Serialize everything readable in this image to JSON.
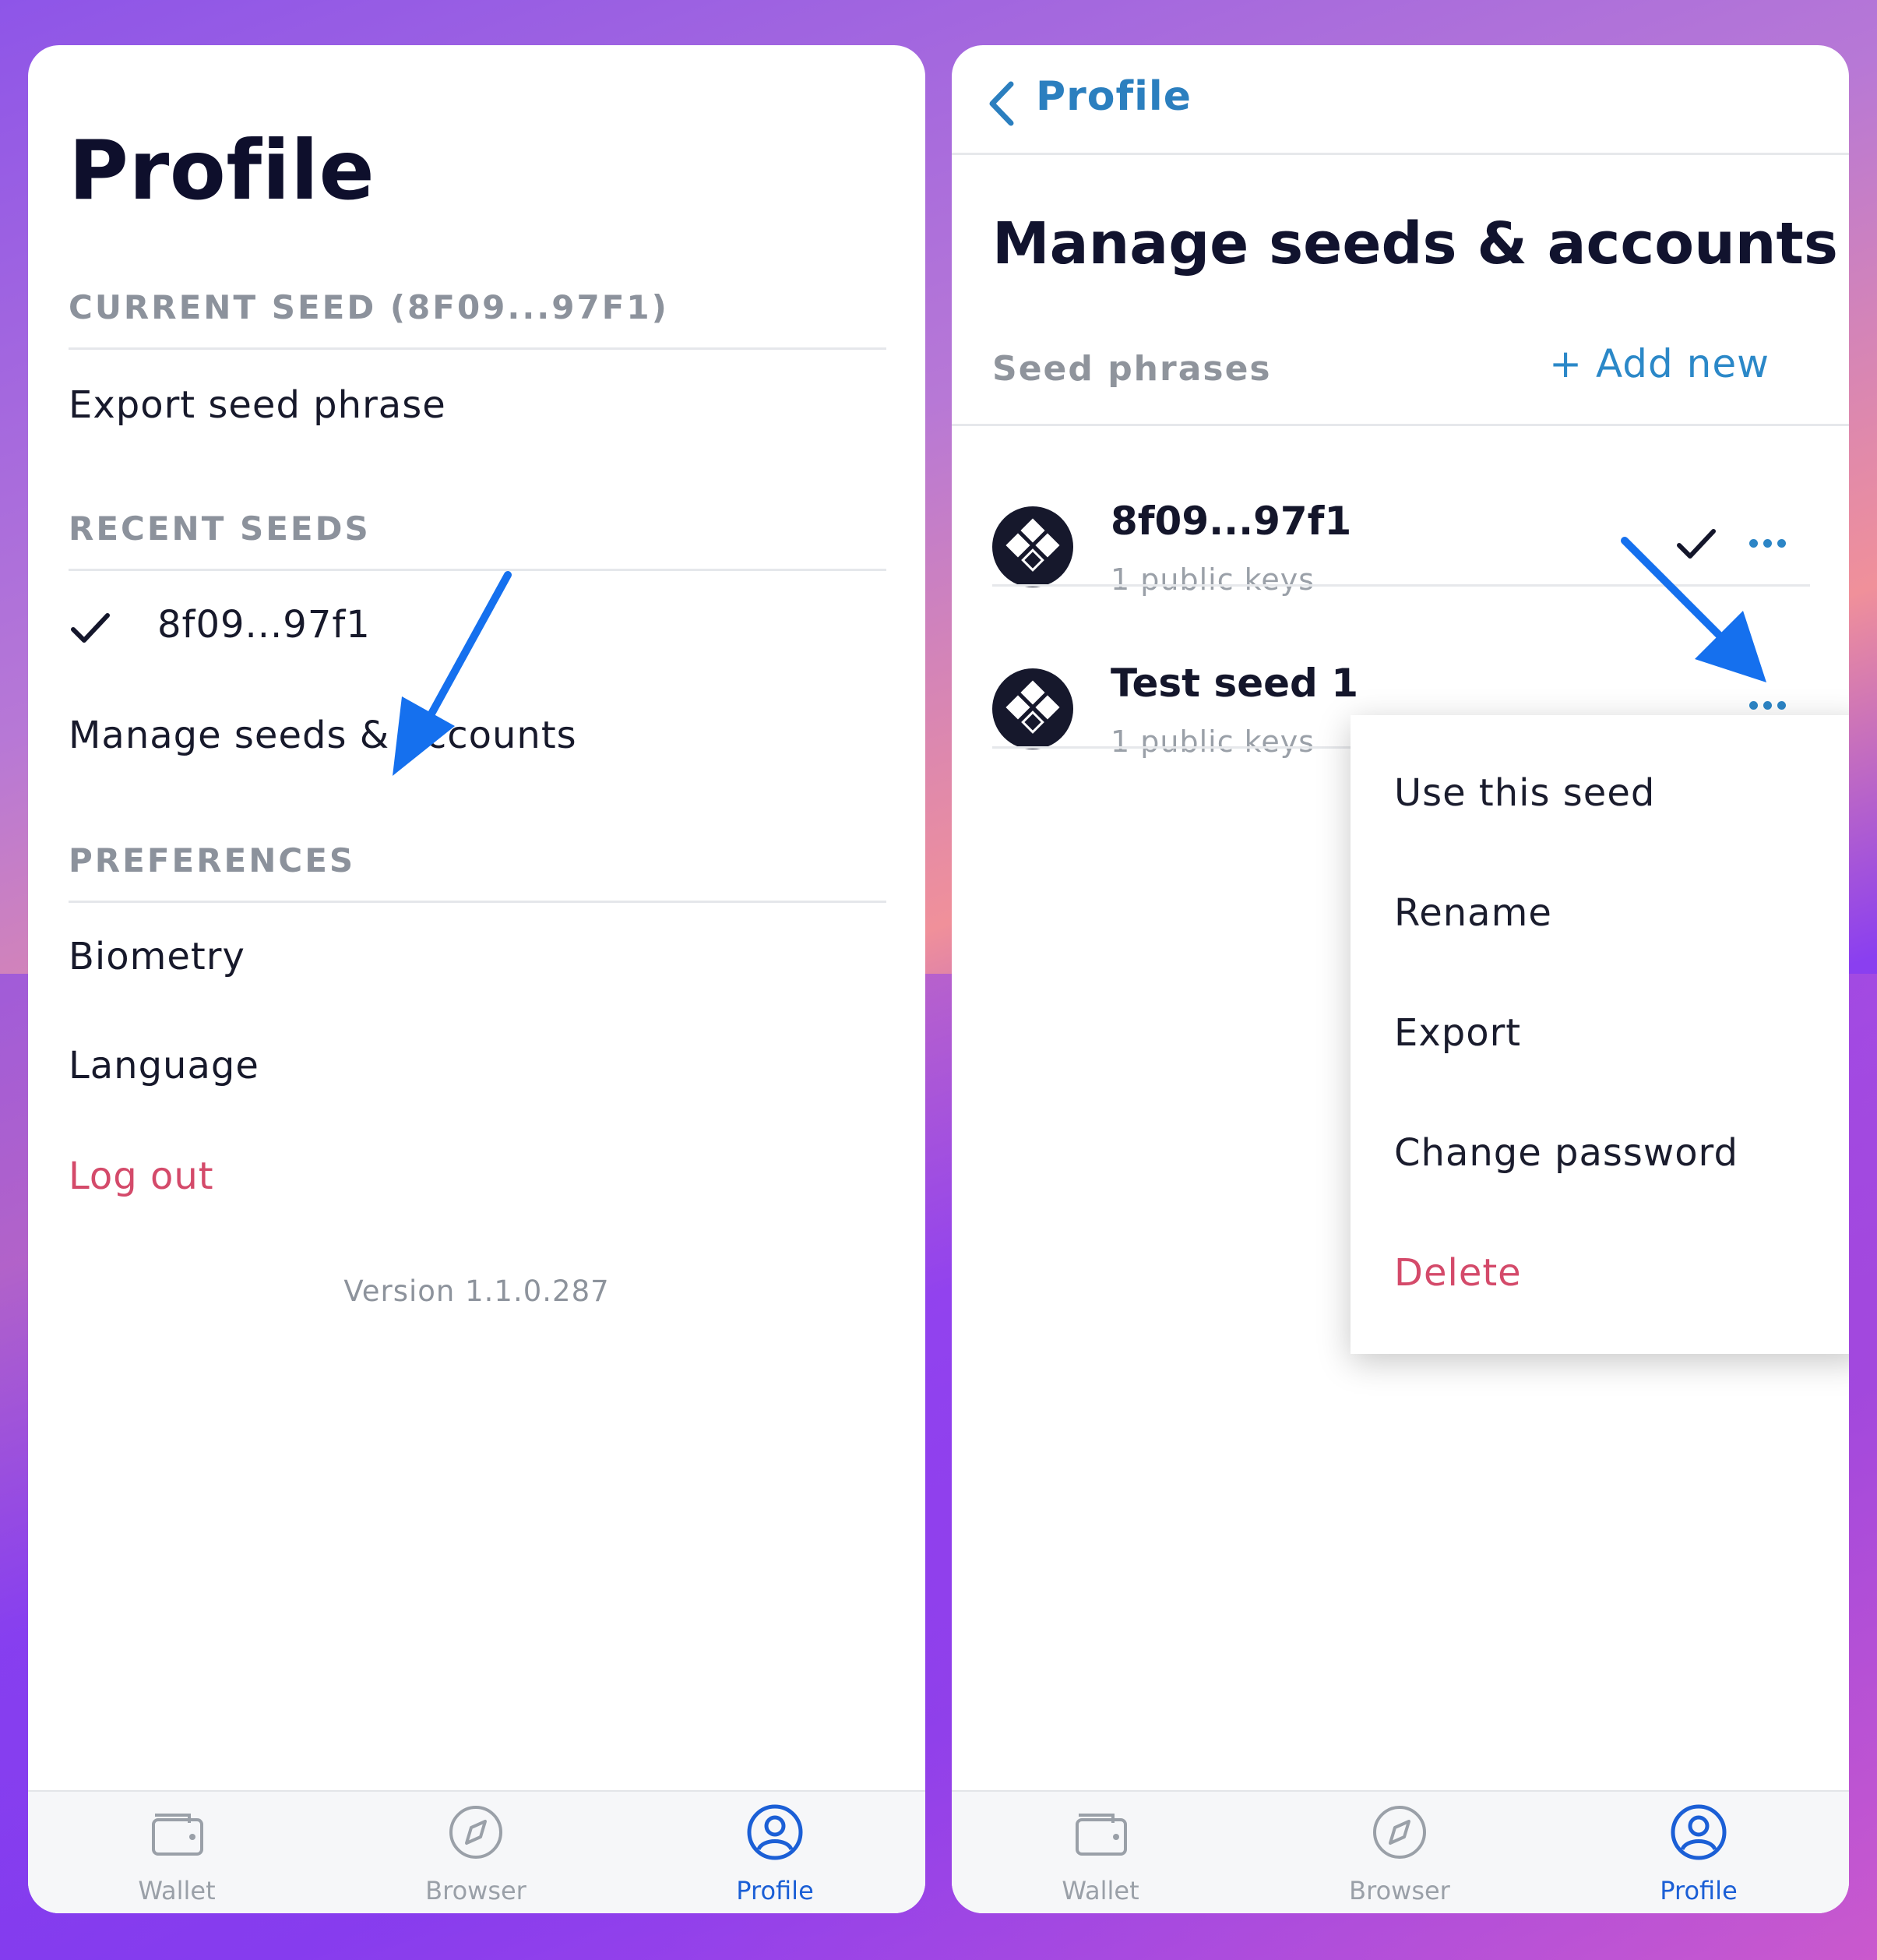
{
  "left": {
    "title": "Profile",
    "current_seed_header": "CURRENT SEED (8F09...97F1)",
    "export_seed_phrase": "Export seed phrase",
    "recent_seeds_header": "RECENT SEEDS",
    "recent_seed_name": "8f09...97f1",
    "manage_seeds": "Manage seeds & accounts",
    "preferences_header": "PREFERENCES",
    "biometry": "Biometry",
    "language": "Language",
    "log_out": "Log out",
    "version": "Version 1.1.0.287"
  },
  "right": {
    "back_label": "Profile",
    "title": "Manage seeds & accounts",
    "seed_phrases_label": "Seed phrases",
    "add_new": "+ Add new",
    "seeds": [
      {
        "name": "8f09...97f1",
        "sub": "1 public keys",
        "selected": true
      },
      {
        "name": "Test seed 1",
        "sub": "1 public keys",
        "selected": false
      }
    ],
    "menu": [
      "Use this seed",
      "Rename",
      "Export",
      "Change password",
      "Delete"
    ]
  },
  "nav": {
    "items": [
      {
        "label": "Wallet",
        "icon": "wallet-icon",
        "active": false
      },
      {
        "label": "Browser",
        "icon": "compass-icon",
        "active": false
      },
      {
        "label": "Profile",
        "icon": "profile-icon",
        "active": true
      }
    ]
  },
  "colors": {
    "accent_blue": "#2b88c8",
    "active_nav": "#1b5fd6",
    "danger": "#d44a6a",
    "annotation_arrow": "#1570ee"
  }
}
